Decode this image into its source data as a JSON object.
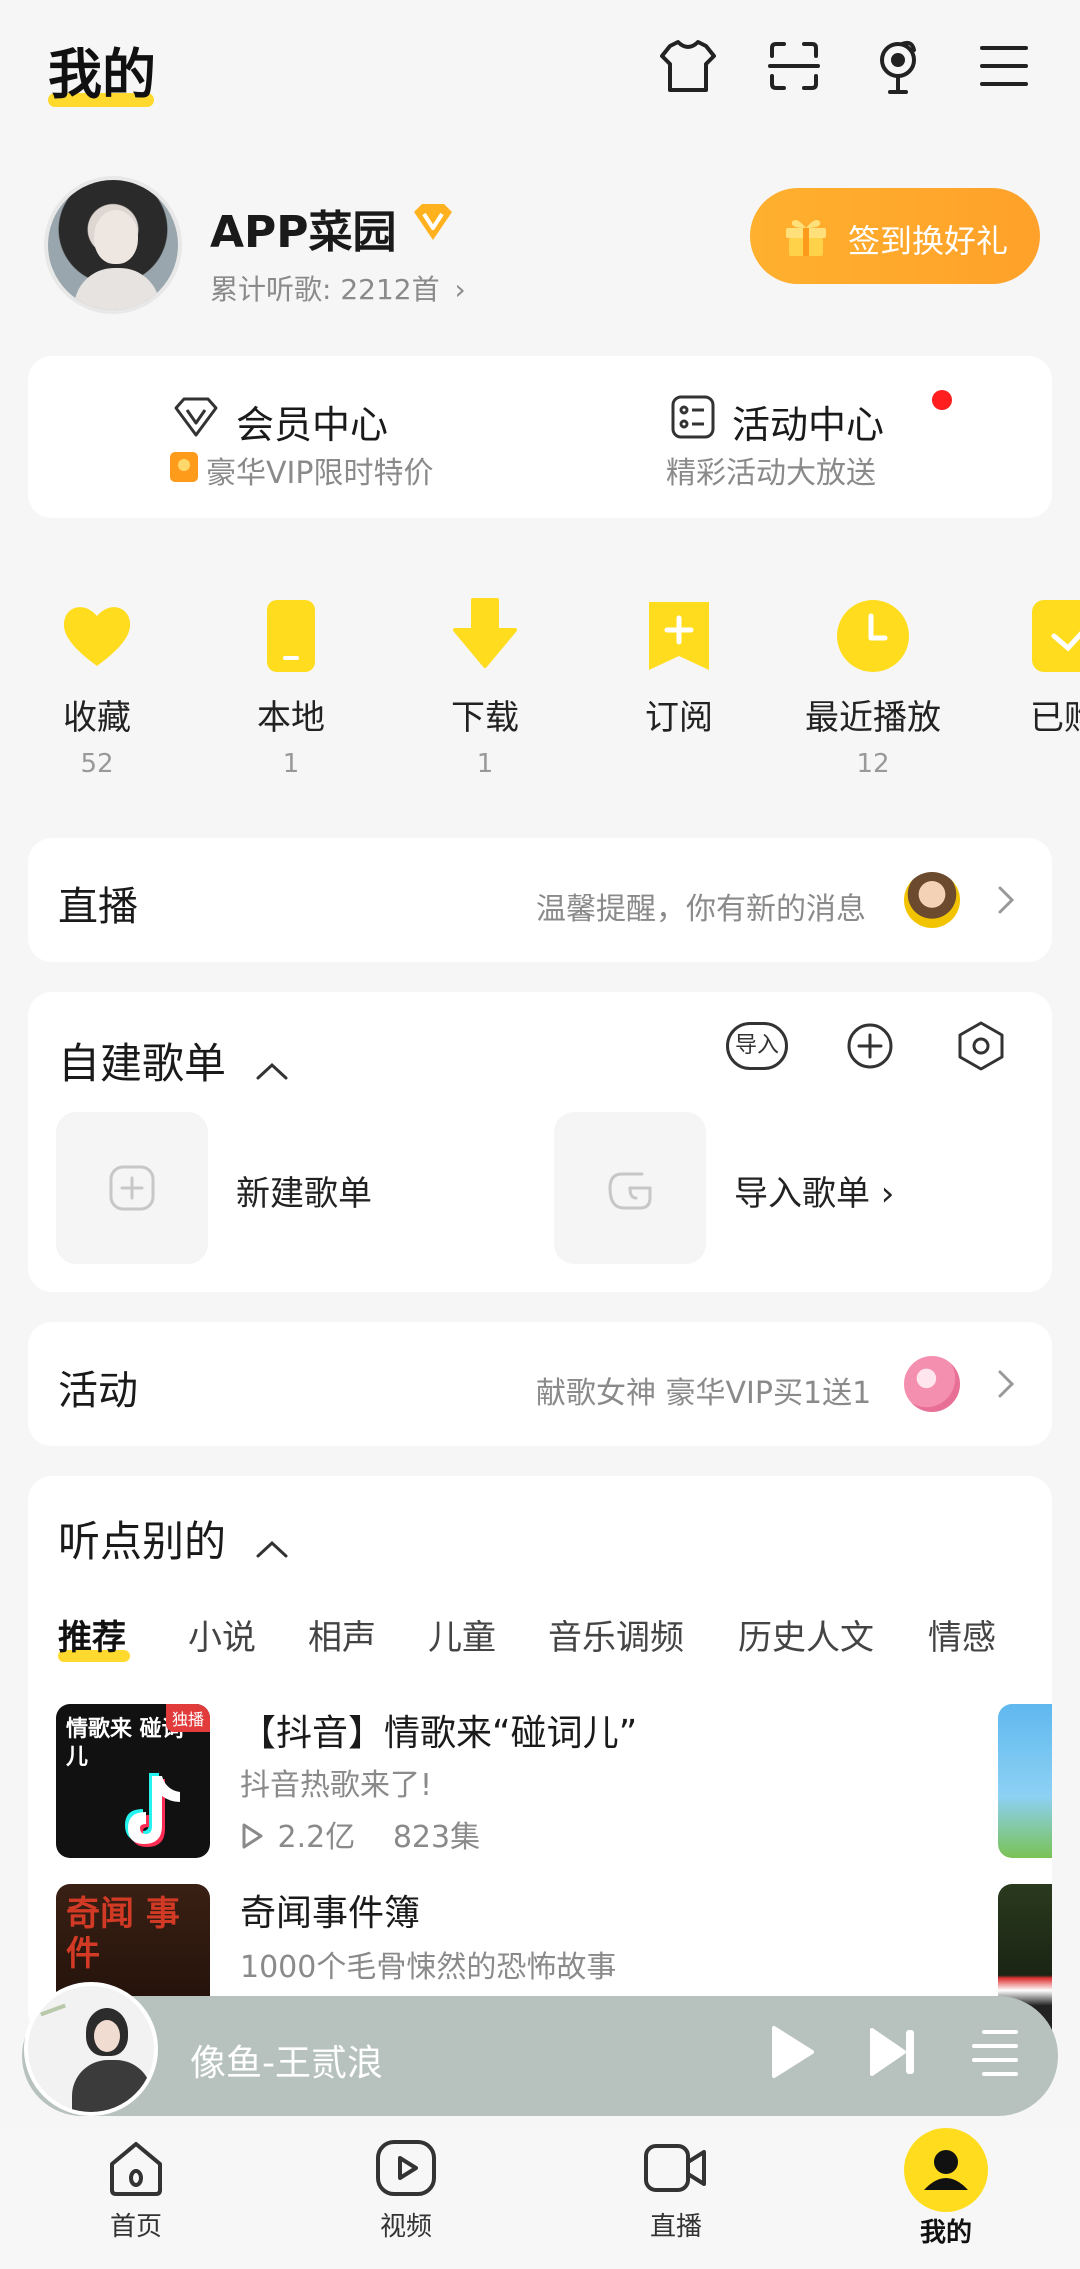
{
  "header": {
    "title": "我的",
    "icons": [
      "skin-icon",
      "scan-icon",
      "mic-icon",
      "menu-icon"
    ]
  },
  "profile": {
    "name": "APP菜园",
    "listen_label": "累计听歌: 2212首",
    "checkin_label": "签到换好礼"
  },
  "member_card": {
    "vip_title": "会员中心",
    "vip_sub": "豪华VIP限时特价",
    "activity_title": "活动中心",
    "activity_sub": "精彩活动大放送"
  },
  "quick": [
    {
      "label": "收藏",
      "count": "52"
    },
    {
      "label": "本地",
      "count": "1"
    },
    {
      "label": "下载",
      "count": "1"
    },
    {
      "label": "订阅",
      "count": ""
    },
    {
      "label": "最近播放",
      "count": "12"
    },
    {
      "label": "已购",
      "count": ""
    }
  ],
  "live": {
    "title": "直播",
    "hint": "温馨提醒，你有新的消息"
  },
  "playlists": {
    "title": "自建歌单",
    "import_badge": "导入",
    "new_label": "新建歌单",
    "import_label": "导入歌单 ›"
  },
  "activity": {
    "title": "活动",
    "hint": "献歌女神 豪华VIP买1送1"
  },
  "listen": {
    "title": "听点别的",
    "tabs": [
      "推荐",
      "小说",
      "相声",
      "儿童",
      "音乐调频",
      "历史人文",
      "情感"
    ],
    "items": [
      {
        "title": "【抖音】情歌来“碰词儿”",
        "desc": "抖音热歌来了!",
        "plays": "2.2亿",
        "episodes": "823集",
        "cover_text": "情歌来 碰词儿",
        "tag": "独播"
      },
      {
        "title": "奇闻事件簿",
        "desc": "1000个毛骨悚然的恐怖故事",
        "cover_text": "奇闻 事件"
      }
    ]
  },
  "player": {
    "song": "像鱼-王贰浪"
  },
  "nav": {
    "items": [
      "首页",
      "视频",
      "直播",
      "我的"
    ],
    "active": "我的"
  },
  "colors": {
    "accent": "#ffd92e",
    "checkin": "#ffa62b",
    "red_dot": "#ff1f1f"
  }
}
